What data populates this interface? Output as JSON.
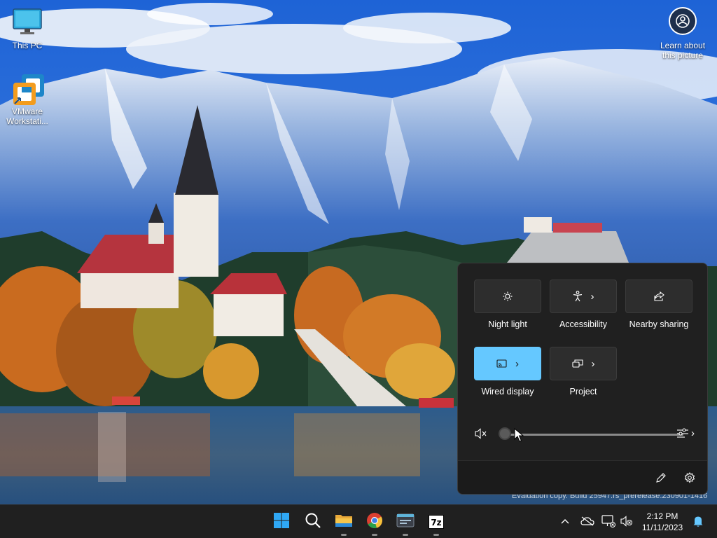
{
  "desktop": {
    "icons": [
      {
        "label": "This PC"
      },
      {
        "label": "VMware\nWorkstati..."
      }
    ],
    "learn_label": "Learn about\nthis picture",
    "watermark": "Evaluation copy. Build 25947.rs_prerelease.230901-1416"
  },
  "quick_settings": {
    "tiles": [
      {
        "label": "Night light",
        "icon": "brightness-icon",
        "active": false,
        "has_chevron": false
      },
      {
        "label": "Accessibility",
        "icon": "accessibility-icon",
        "active": false,
        "has_chevron": true
      },
      {
        "label": "Nearby sharing",
        "icon": "share-icon",
        "active": false,
        "has_chevron": false
      },
      {
        "label": "Wired display",
        "icon": "cast-icon",
        "active": true,
        "has_chevron": true
      },
      {
        "label": "Project",
        "icon": "project-icon",
        "active": false,
        "has_chevron": true
      }
    ],
    "chevron": "›",
    "volume": {
      "level": 0,
      "muted": true
    }
  },
  "taskbar": {
    "apps": [
      "start",
      "search",
      "file-explorer",
      "chrome",
      "terminal",
      "7zip"
    ],
    "sevenzip_label": "7z",
    "tray_chevron": "^",
    "clock": {
      "time": "2:12 PM",
      "date": "11/11/2023"
    }
  },
  "colors": {
    "accent": "#65c8ff",
    "flyout_bg": "#202020",
    "taskbar_bg": "#202020"
  }
}
